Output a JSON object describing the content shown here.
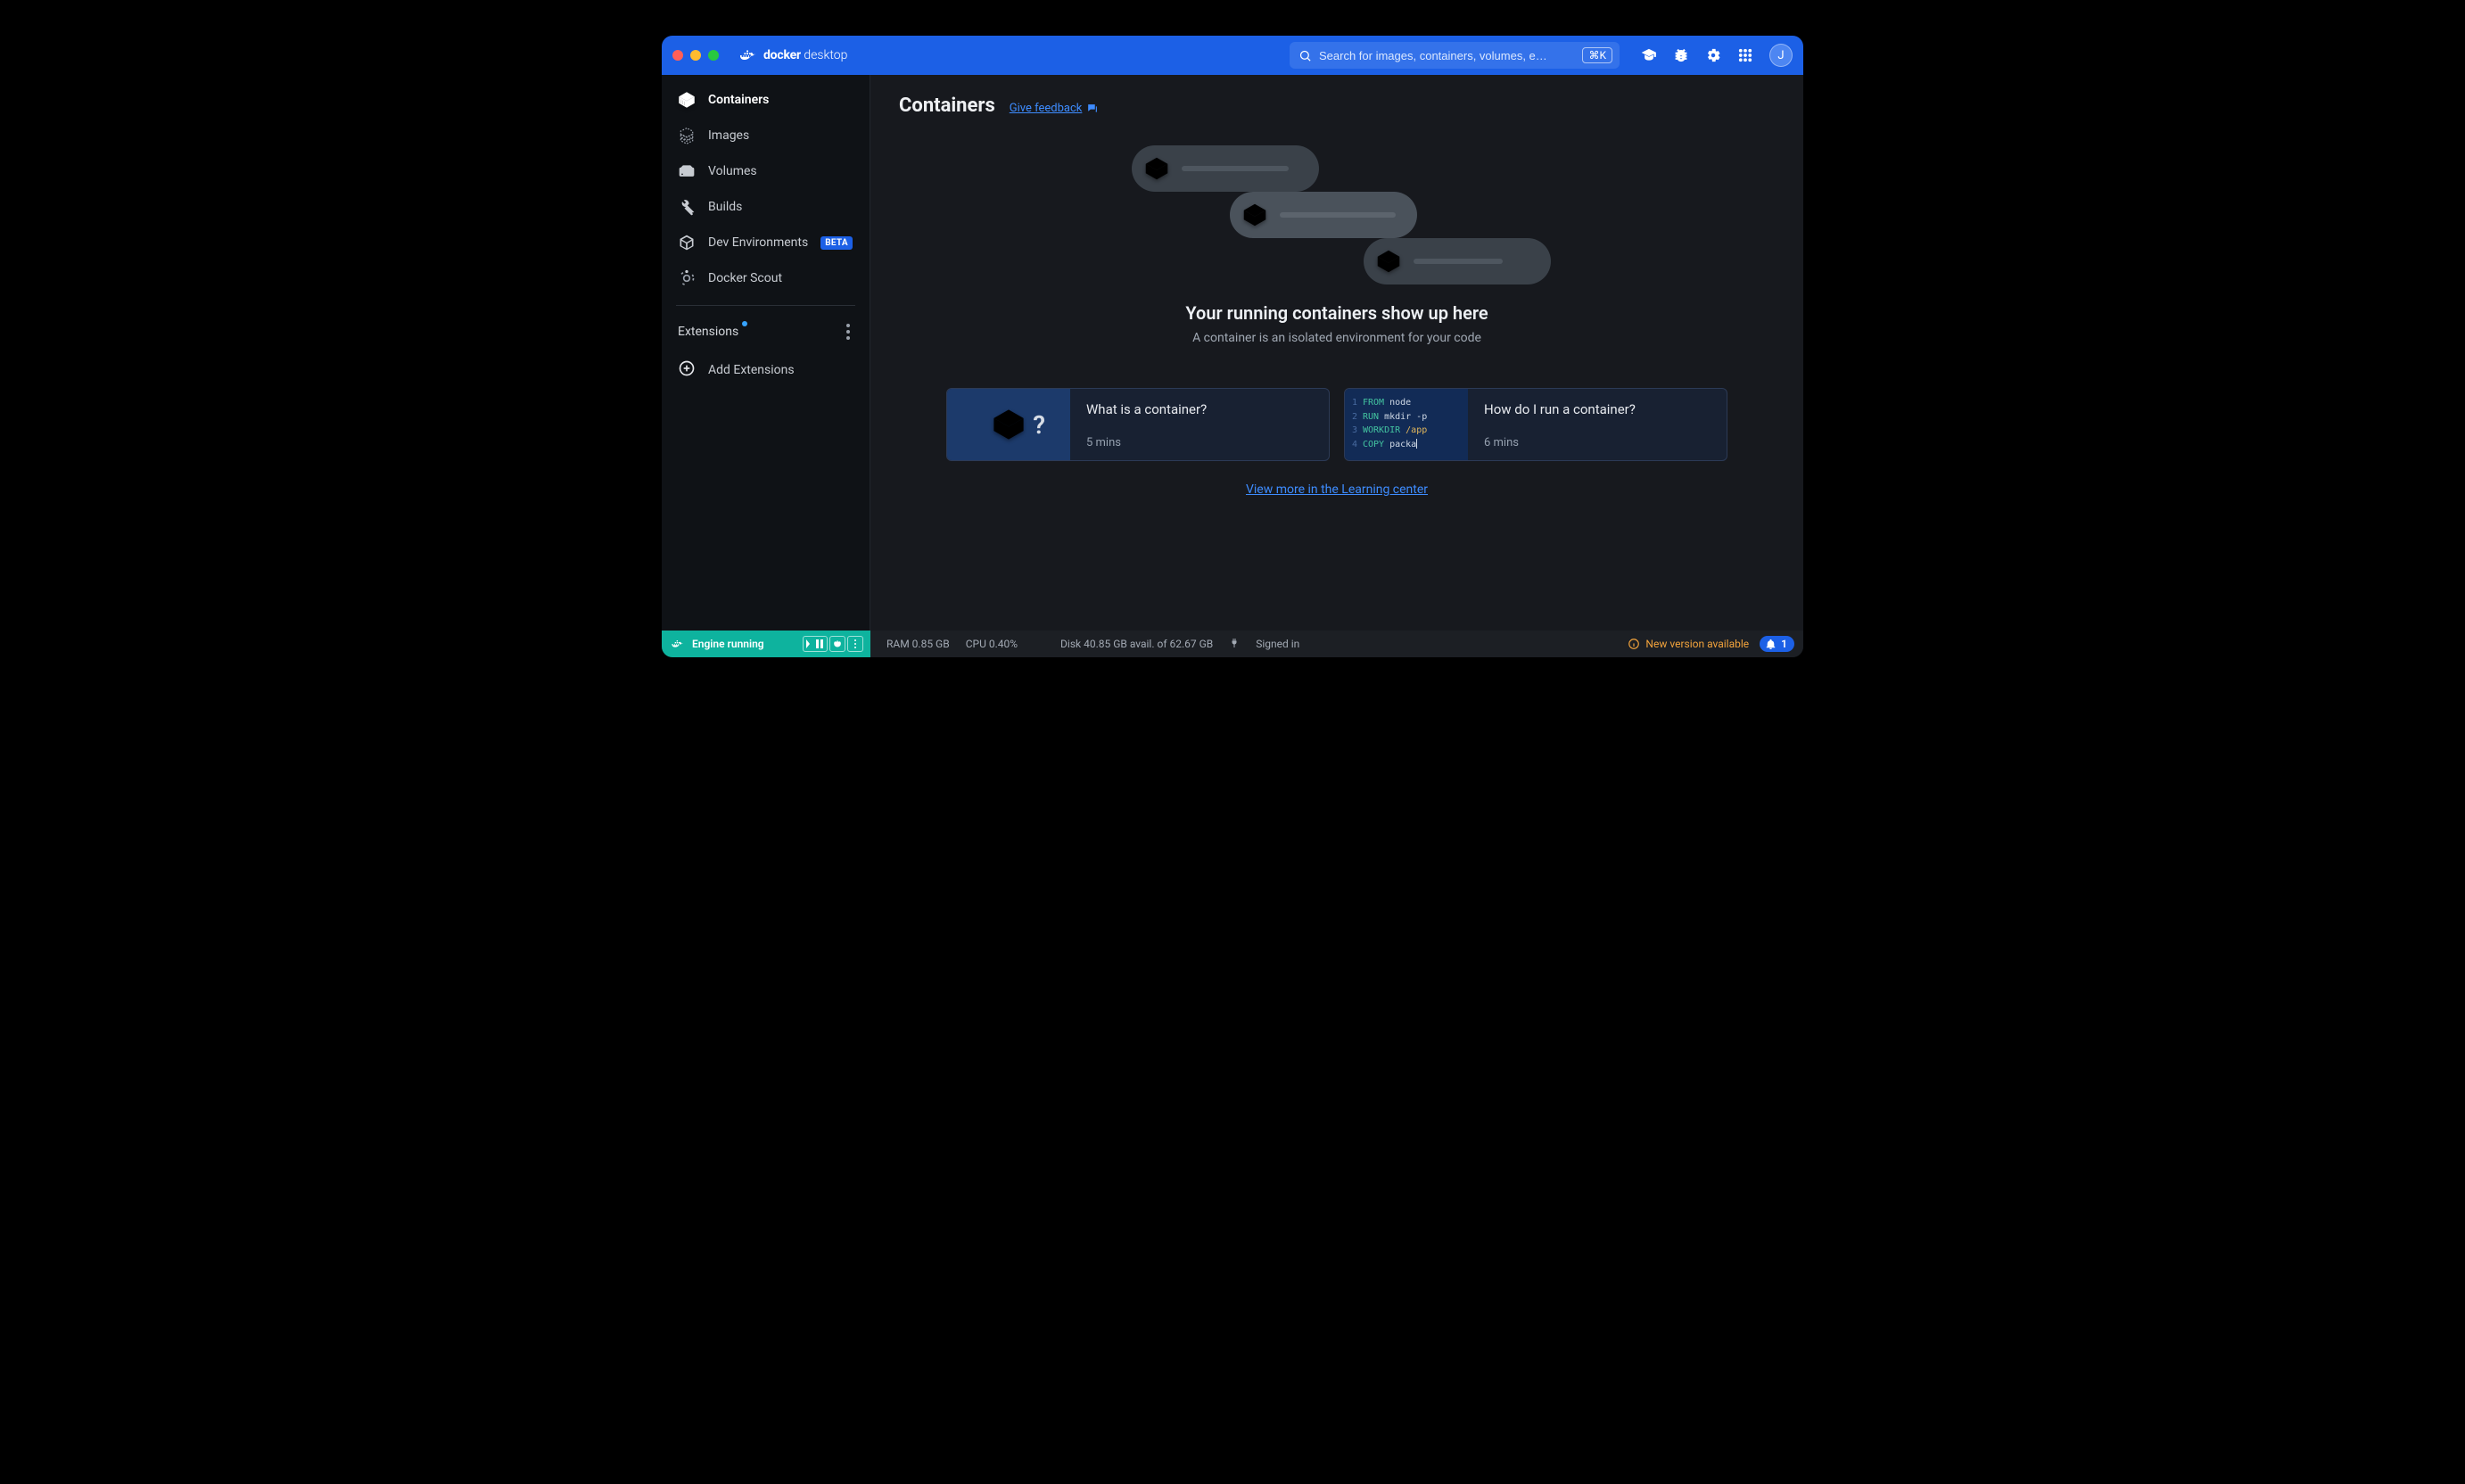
{
  "brand": {
    "a": "docker",
    "b": "desktop"
  },
  "search": {
    "placeholder": "Search for images, containers, volumes, e…",
    "shortcut": "⌘K"
  },
  "avatar": {
    "initial": "J"
  },
  "sidebar": {
    "items": [
      {
        "label": "Containers"
      },
      {
        "label": "Images"
      },
      {
        "label": "Volumes"
      },
      {
        "label": "Builds"
      },
      {
        "label": "Dev Environments",
        "badge": "BETA"
      },
      {
        "label": "Docker Scout"
      }
    ],
    "extensions_title": "Extensions",
    "add_extensions": "Add Extensions"
  },
  "page": {
    "title": "Containers",
    "feedback": "Give feedback"
  },
  "hero": {
    "title": "Your running containers show up here",
    "subtitle": "A container is an isolated environment for your code"
  },
  "cards": [
    {
      "title": "What is a container?",
      "duration": "5 mins"
    },
    {
      "title": "How do I run a container?",
      "duration": "6 mins"
    }
  ],
  "code_thumb": {
    "lines": [
      {
        "n": "1",
        "kw": "FROM",
        "rest": "node"
      },
      {
        "n": "2",
        "kw": "RUN",
        "rest": "mkdir -p"
      },
      {
        "n": "3",
        "kw": "WORKDIR",
        "rest": "/app"
      },
      {
        "n": "4",
        "kw": "COPY",
        "rest": "packa"
      }
    ]
  },
  "learning_link": "View more in the Learning center",
  "status": {
    "engine": "Engine running",
    "ram": "RAM 0.85 GB",
    "cpu": "CPU 0.40%",
    "disk": "Disk 40.85 GB avail. of 62.67 GB",
    "signed": "Signed in",
    "new_version": "New version available",
    "notif_count": "1"
  }
}
